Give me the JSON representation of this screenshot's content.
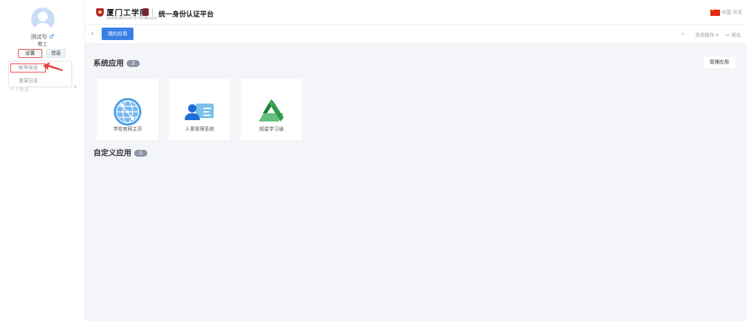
{
  "sidebar": {
    "user_name": "测试号",
    "gender_symbol": "♂",
    "role": "教工",
    "tab_settings_label": "设置",
    "tab_info_label": "信息",
    "dropdown": {
      "account_security": "帐号安全",
      "login_log": "登录日志"
    },
    "collapse_icon": "‹",
    "hidden_text": "个人信息"
  },
  "header": {
    "school_name": "厦门工学院",
    "school_name_en": "XIAMEN INSTITUTE OF TECHNOLOGY",
    "app_title": "统一身份认证平台",
    "language": "中国 中文"
  },
  "tabbar": {
    "back_icon": "«",
    "active_tab_label": "我的应用",
    "forward_icon": "»",
    "close_ops_label": "关闭操作 ▾",
    "logout_label": "⇨ 退出"
  },
  "main": {
    "system_apps_title": "系统应用",
    "system_apps_count": "3",
    "manage_apps_label": "管理应用",
    "custom_apps_title": "自定义应用",
    "custom_apps_count": "0",
    "apps": [
      {
        "label": "学校官网主页",
        "icon": "globe-icon"
      },
      {
        "label": "人事管理系统",
        "icon": "personnel-card-icon"
      },
      {
        "label": "超星学习通",
        "icon": "chaoxing-logo-icon"
      }
    ]
  },
  "colors": {
    "accent": "#3a7ee6",
    "annotation_red": "#e64545",
    "main_bg": "#f3f5f8"
  }
}
